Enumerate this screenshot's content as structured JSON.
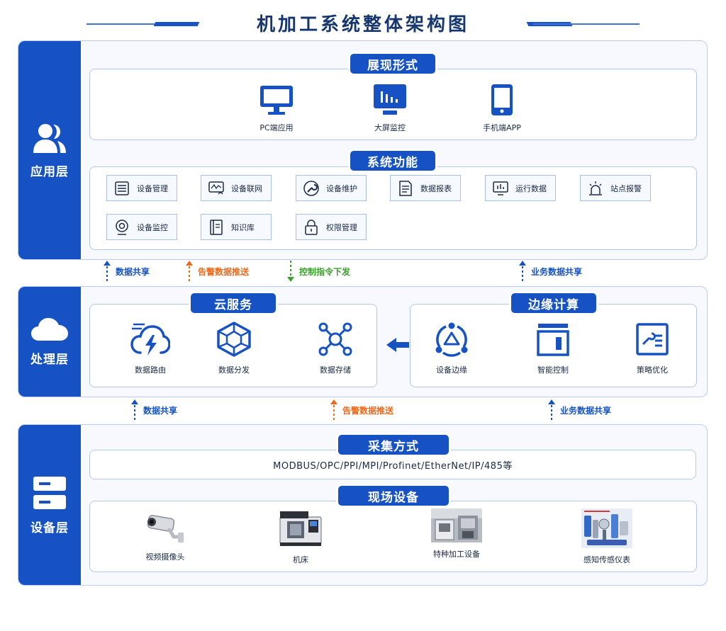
{
  "title": "机加工系统整体架构图",
  "colors": {
    "primary": "#1652c4",
    "share": "#1652c4",
    "alarm": "#ee6a1a",
    "control": "#3aa12b"
  },
  "app_layer": {
    "label": "应用层",
    "display": {
      "title": "展现形式",
      "items": [
        {
          "label": "PC端应用",
          "icon": "monitor-icon"
        },
        {
          "label": "大屏监控",
          "icon": "big-screen-icon"
        },
        {
          "label": "手机端APP",
          "icon": "phone-icon"
        }
      ]
    },
    "functions": {
      "title": "系统功能",
      "items": [
        {
          "label": "设备管理",
          "icon": "list-icon"
        },
        {
          "label": "设备联网",
          "icon": "network-icon"
        },
        {
          "label": "设备维护",
          "icon": "wrench-icon"
        },
        {
          "label": "数据报表",
          "icon": "report-icon"
        },
        {
          "label": "运行数据",
          "icon": "chart-monitor-icon"
        },
        {
          "label": "站点报警",
          "icon": "alarm-light-icon"
        },
        {
          "label": "设备监控",
          "icon": "webcam-icon"
        },
        {
          "label": "知识库",
          "icon": "book-icon"
        },
        {
          "label": "权限管理",
          "icon": "lock-icon"
        }
      ]
    }
  },
  "flows_upper": [
    {
      "label": "数据共享",
      "kind": "share",
      "dir": "up"
    },
    {
      "label": "告警数据推送",
      "kind": "alarm",
      "dir": "up"
    },
    {
      "label": "控制指令下发",
      "kind": "control",
      "dir": "down"
    },
    {
      "label": "业务数据共享",
      "kind": "share",
      "dir": "up"
    }
  ],
  "processing_layer": {
    "label": "处理层",
    "cloud": {
      "title": "云服务",
      "items": [
        {
          "label": "数据路由",
          "icon": "cloud-bolt-icon"
        },
        {
          "label": "数据分发",
          "icon": "hexagon-network-icon"
        },
        {
          "label": "数据存储",
          "icon": "nodes-icon"
        }
      ]
    },
    "edge": {
      "title": "边缘计算",
      "items": [
        {
          "label": "设备边缘",
          "icon": "edge-device-icon"
        },
        {
          "label": "智能控制",
          "icon": "smart-control-icon"
        },
        {
          "label": "策略优化",
          "icon": "strategy-icon"
        }
      ]
    }
  },
  "flows_lower": [
    {
      "label": "数据共享",
      "kind": "share",
      "dir": "up"
    },
    {
      "label": "告警数据推送",
      "kind": "alarm",
      "dir": "up"
    },
    {
      "label": "业务数据共享",
      "kind": "share",
      "dir": "up"
    }
  ],
  "device_layer": {
    "label": "设备层",
    "collect": {
      "title": "采集方式",
      "protocols": "MODBUS/OPC/PPI/MPI/Profinet/EtherNet/IP/485等"
    },
    "field": {
      "title": "现场设备",
      "items": [
        {
          "label": "视频摄像头"
        },
        {
          "label": "机床"
        },
        {
          "label": "特种加工设备"
        },
        {
          "label": "感知传感仪表"
        }
      ]
    }
  }
}
